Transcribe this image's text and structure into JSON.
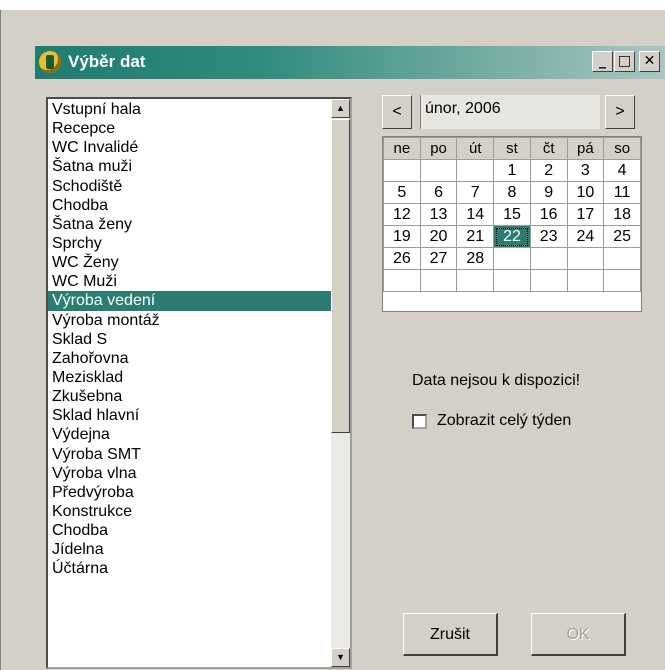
{
  "window": {
    "title": "Výběr dat",
    "minimize_label": "_",
    "maximize_label": "□",
    "close_label": "✕"
  },
  "locations": {
    "items": [
      "Vstupní hala",
      "Recepce",
      "WC Invalidé",
      "Šatna muži",
      "Schodiště",
      "Chodba",
      "Šatna ženy",
      "Sprchy",
      "WC Ženy",
      "WC Muži",
      "Výroba vedení",
      "Výroba montáž",
      "Sklad S",
      "Zahořovna",
      "Mezisklad",
      "Zkušebna",
      "Sklad hlavní",
      "Výdejna",
      "Výroba SMT",
      "Výroba vlna",
      "Předvýroba",
      "Konstrukce",
      "Chodba",
      "Jídelna",
      "Účtárna"
    ],
    "selected_index": 10
  },
  "calendar": {
    "month_label": "únor, 2006",
    "prev_label": "<",
    "next_label": ">",
    "weekdays": [
      "ne",
      "po",
      "út",
      "st",
      "čt",
      "pá",
      "so"
    ],
    "weeks": [
      [
        "",
        "",
        "",
        "1",
        "2",
        "3",
        "4"
      ],
      [
        "5",
        "6",
        "7",
        "8",
        "9",
        "10",
        "11"
      ],
      [
        "12",
        "13",
        "14",
        "15",
        "16",
        "17",
        "18"
      ],
      [
        "19",
        "20",
        "21",
        "22",
        "23",
        "24",
        "25"
      ],
      [
        "26",
        "27",
        "28",
        "",
        "",
        "",
        ""
      ],
      [
        "",
        "",
        "",
        "",
        "",
        "",
        ""
      ]
    ],
    "selected_day": "22"
  },
  "status_text": "Data nejsou k dispozici!",
  "whole_week": {
    "label": "Zobrazit celý týden",
    "checked": false
  },
  "buttons": {
    "cancel": "Zrušit",
    "ok": "OK"
  },
  "colors": {
    "selection": "#2a7d70",
    "titlebar_start": "#1f7c6e",
    "face": "#d4d0c8"
  }
}
